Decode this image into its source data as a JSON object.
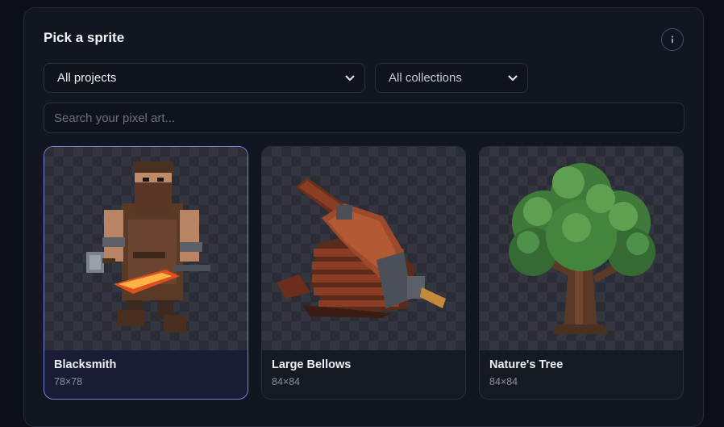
{
  "picker": {
    "title": "Pick a sprite",
    "info_icon": "info-icon",
    "project_filter": {
      "selected": "All projects"
    },
    "collection_filter": {
      "selected": "All collections"
    },
    "search": {
      "placeholder": "Search your pixel art...",
      "value": ""
    }
  },
  "sprites": [
    {
      "name": "Blacksmith",
      "size": "78×78",
      "selected": true,
      "icon": "blacksmith-sprite"
    },
    {
      "name": "Large Bellows",
      "size": "84×84",
      "selected": false,
      "icon": "bellows-sprite"
    },
    {
      "name": "Nature's Tree",
      "size": "84×84",
      "selected": false,
      "icon": "tree-sprite"
    }
  ],
  "colors": {
    "accent": "#7b7fd6",
    "panel": "#121620",
    "background": "#0c0f18"
  }
}
